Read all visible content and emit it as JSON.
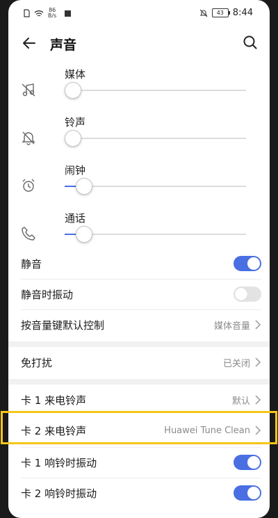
{
  "statusbar": {
    "net_top": "86",
    "net_bottom": "B/s",
    "battery": "43",
    "time": "8:44"
  },
  "header": {
    "title": "声音"
  },
  "volumes": [
    {
      "label": "媒体",
      "level": 0
    },
    {
      "label": "铃声",
      "level": 0
    },
    {
      "label": "闹钟",
      "level": 0.06
    },
    {
      "label": "通话",
      "level": 0.06
    }
  ],
  "rows": {
    "silent": {
      "label": "静音",
      "on": true
    },
    "silent_vibrate": {
      "label": "静音时振动",
      "on": false
    },
    "volume_key": {
      "label": "按音量键默认控制",
      "value": "媒体音量"
    },
    "dnd": {
      "label": "免打扰",
      "value": "已关闭"
    },
    "sim1_ringtone": {
      "label": "卡 1 来电铃声",
      "value": "默认"
    },
    "sim2_ringtone": {
      "label": "卡 2 来电铃声",
      "value": "Huawei Tune Clean"
    },
    "sim1_vibrate": {
      "label": "卡 1 响铃时振动",
      "on": true
    },
    "sim2_vibrate": {
      "label": "卡 2 响铃时振动",
      "on": true
    }
  },
  "colors": {
    "accent": "#4a6fe3",
    "highlight": "#f5c518"
  }
}
